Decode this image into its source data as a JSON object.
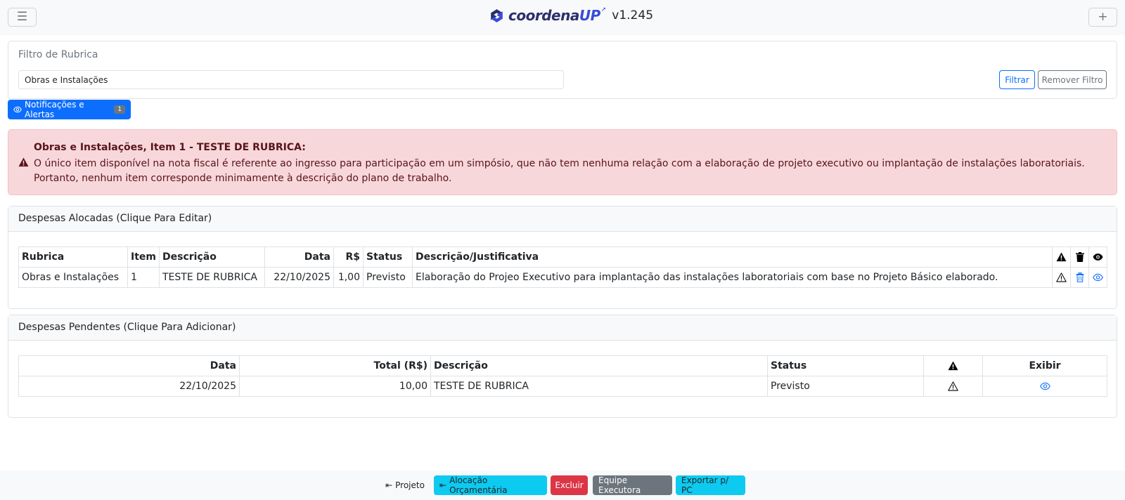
{
  "navbar": {
    "menu_icon": "hamburger-icon",
    "brand_name": "coordena",
    "brand_name_accent": "UP",
    "version": "v1.245",
    "add_icon": "plus-icon"
  },
  "filter": {
    "title": "Filtro de Rubrica",
    "input_value": "Obras e Instalações",
    "filter_button": "Filtrar",
    "remove_button": "Remover Filtro"
  },
  "notifications": {
    "label": "Notificações e Alertas",
    "count": "1"
  },
  "alert": {
    "title": "Obras e Instalações, Item 1 - TESTE DE RUBRICA:",
    "text": "O único item disponível na nota fiscal é referente ao ingresso para participação em um simpósio, que não tem nenhuma relação com a elaboração de projeto executivo ou implantação de instalações laboratoriais. Portanto, nenhum item corresponde minimamente à descrição do plano de trabalho."
  },
  "allocated": {
    "header": "Despesas Alocadas (Clique Para Editar)",
    "columns": [
      "Rubrica",
      "Item",
      "Descrição",
      "Data",
      "R$",
      "Status",
      "Descrição/Justificativa"
    ],
    "rows": [
      {
        "rubrica": "Obras e Instalações",
        "item": "1",
        "descricao": "TESTE DE RUBRICA",
        "data": "22/10/2025",
        "valor": "1,00",
        "status": "Previsto",
        "justificativa": "Elaboração do Projeo Executivo para implantação das instalações laboratoriais com base no Projeto Básico elaborado."
      }
    ]
  },
  "pending": {
    "header": "Despesas Pendentes (Clique Para Adicionar)",
    "columns": [
      "Data",
      "Total (R$)",
      "Descrição",
      "Status",
      "Exibir"
    ],
    "rows": [
      {
        "data": "22/10/2025",
        "total": "10,00",
        "descricao": "TESTE DE RUBRICA",
        "status": "Previsto"
      }
    ]
  },
  "bottombar": {
    "projeto": "Projeto",
    "alocacao": "Alocação Orçamentária",
    "excluir": "Excluir",
    "equipe": "Equipe Executora",
    "exportar": "Exportar p/ PC"
  },
  "colors": {
    "primary": "#0d6efd",
    "info": "#0dcaf0",
    "danger": "#dc3545",
    "secondary": "#6c757d",
    "alert_bg": "#f8d7da"
  }
}
